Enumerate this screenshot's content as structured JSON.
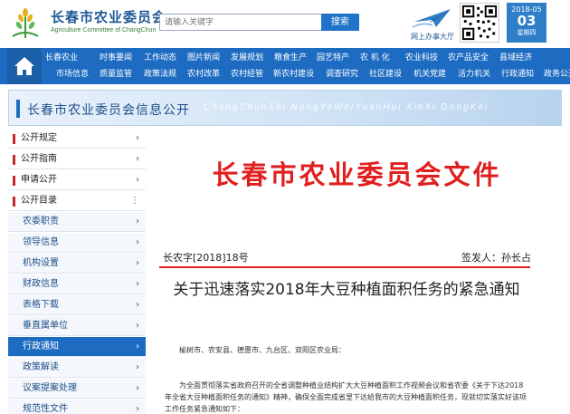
{
  "header": {
    "title": "长春市农业委员会",
    "subtitle": "Agriculture Committee of ChangChun",
    "logo_icon": "wheat-logo-icon",
    "search_placeholder": "请输入关键字",
    "search_button": "搜索",
    "online_service": "网上办事大厅",
    "date": {
      "year_month": "2018-05",
      "day": "03",
      "weekday": "星期四"
    }
  },
  "nav": {
    "home_icon": "home-icon",
    "row1": [
      "长春农业",
      "时事要闻",
      "工作动态",
      "图片新闻",
      "发展规划",
      "粮食生产",
      "园艺特产",
      "农 机 化",
      "农业科技",
      "农产品安全",
      "县域经济"
    ],
    "row2": [
      "市场信息",
      "质量监管",
      "政策法规",
      "农村改革",
      "农村经管",
      "新农村建设",
      "调查研究",
      "社区建设",
      "机关党建",
      "活力机关",
      "行政通知",
      "政务公开"
    ]
  },
  "banner": {
    "title": "长春市农业委员会信息公开",
    "en": "ChangChunShi NongYeWeiYuanHui XinXi GongKai"
  },
  "sidebar": {
    "items": [
      {
        "label": "公开规定",
        "arrow": "›"
      },
      {
        "label": "公开指南",
        "arrow": "›"
      },
      {
        "label": "申请公开",
        "arrow": "›"
      },
      {
        "label": "公开目录",
        "arrow": "⋮"
      }
    ],
    "subitems": [
      {
        "label": "农委职责",
        "arrow": "›"
      },
      {
        "label": "领导信息",
        "arrow": "›"
      },
      {
        "label": "机构设置",
        "arrow": "›"
      },
      {
        "label": "财政信息",
        "arrow": "›"
      },
      {
        "label": "表格下载",
        "arrow": "›"
      },
      {
        "label": "垂直属单位",
        "arrow": "›"
      },
      {
        "label": "行政通知",
        "arrow": "›"
      },
      {
        "label": "政策解读",
        "arrow": "›"
      },
      {
        "label": "议案提案处理",
        "arrow": "›"
      },
      {
        "label": "规范性文件",
        "arrow": "›"
      }
    ],
    "active": "行政通知"
  },
  "document": {
    "header": "长春市农业委员会文件",
    "number": "长农字[2018]18号",
    "signer": "签发人：孙长占",
    "title": "关于迅速落实2018年大豆种植面积任务的紧急通知",
    "addressee": "榆树市、农安县、德惠市、九台区、双阳区农业局：",
    "body": "为全面贯彻落实省政府召开的全省调整种植业结构扩大大豆种植面积工作视频会议和省农委《关于下达2018年全省大豆种植面积任务的通知》精神，确保全面完成省里下达给我市的大豆种植面积任务，现就切实落实好该项工作任务紧急通知如下："
  },
  "colors": {
    "brand_blue": "#1d6cc2",
    "doc_red": "#e02020"
  }
}
